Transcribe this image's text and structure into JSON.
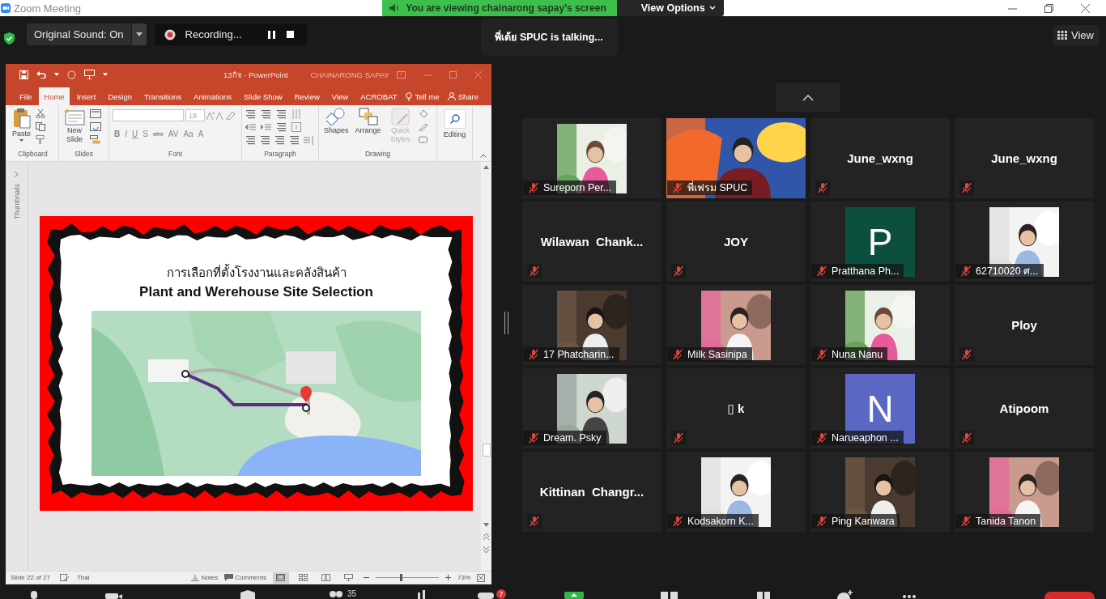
{
  "window": {
    "title": "Zoom Meeting"
  },
  "share_banner": {
    "text": "You are viewing chainarong sapay's screen",
    "view_options": "View Options"
  },
  "meeting_toolbar": {
    "original_sound": "Original Sound: On",
    "recording": "Recording...",
    "talking": "พี่เต้ย SPUC is talking...",
    "view": "View"
  },
  "powerpoint": {
    "title": "13กิจ  -  PowerPoint",
    "user": "CHAINARONG SAPAY",
    "tabs": [
      {
        "label": "File",
        "selected": false
      },
      {
        "label": "Home",
        "selected": true
      },
      {
        "label": "Insert",
        "selected": false
      },
      {
        "label": "Design",
        "selected": false
      },
      {
        "label": "Transitions",
        "selected": false
      },
      {
        "label": "Animations",
        "selected": false
      },
      {
        "label": "Slide Show",
        "selected": false
      },
      {
        "label": "Review",
        "selected": false
      },
      {
        "label": "View",
        "selected": false
      },
      {
        "label": "ACROBAT",
        "selected": false
      }
    ],
    "tell_me": "Tell me",
    "share": "Share",
    "ribbon": [
      {
        "kind": "clipboard",
        "label": "Clipboard",
        "button": "Paste"
      },
      {
        "kind": "slides",
        "label": "Slides",
        "button": "New Slide"
      },
      {
        "kind": "font",
        "label": "Font",
        "font_size": "18",
        "buttons": [
          "B",
          "I",
          "U",
          "S",
          "abc",
          "AV",
          "Aa",
          "A"
        ]
      },
      {
        "kind": "paragraph",
        "label": "Paragraph"
      },
      {
        "kind": "drawing",
        "label": "Drawing",
        "buttons": [
          {
            "label": "Shapes",
            "disabled": false
          },
          {
            "label": "Arrange",
            "disabled": false
          },
          {
            "label": "Quick Styles",
            "disabled": true
          }
        ]
      },
      {
        "kind": "editing",
        "button": "Editing"
      }
    ],
    "thumbnails_label": "Thumbnails",
    "slide": {
      "title_th": "การเลือกที่ตั้งโรงงานและคลังสินค้า",
      "title_en": "Plant and Werehouse Site Selection"
    },
    "status_bar": {
      "slide": "Slide 22 of 27",
      "language": "Thai",
      "notes": "Notes",
      "comments": "Comments",
      "zoom": "73%",
      "zoom_slider": {
        "level": 0.4
      }
    }
  },
  "gallery": {
    "tiles": [
      {
        "name": "Sureporn Per...",
        "muted": true
      },
      {
        "kind": "video",
        "name": "พี่เฟรม SPUC",
        "muted": true
      },
      {
        "kind": "name",
        "name": "June_wxng",
        "muted": true
      },
      {
        "kind": "name",
        "name": "June_wxng",
        "muted": true
      },
      {
        "kind": "name",
        "name": "Wilawan  Chank...",
        "muted": true
      },
      {
        "kind": "name",
        "name": "JOY",
        "muted": true
      },
      {
        "kind": "avatar",
        "name": "Pratthana Ph...",
        "letter": "P",
        "color": "#0c4f3e",
        "muted": true
      },
      {
        "name": "62710020 ศ...",
        "muted": true
      },
      {
        "name": "17 Phatcharin...",
        "muted": true
      },
      {
        "name": "Milk Sasinipa",
        "muted": true
      },
      {
        "name": "Nuna Nanu",
        "muted": true
      },
      {
        "kind": "name",
        "name": "Ploy",
        "muted": true
      },
      {
        "name": "Dream. Psky",
        "muted": true
      },
      {
        "kind": "name",
        "name": "▯ k",
        "muted": true
      },
      {
        "kind": "avatar",
        "name": "Narueaphon ...",
        "letter": "N",
        "color": "#5a68c4",
        "muted": true
      },
      {
        "kind": "name",
        "name": "Atipoom",
        "muted": true
      },
      {
        "kind": "name",
        "name": "Kittinan  Changr...",
        "muted": true
      },
      {
        "name": "Kodsakorn K...",
        "muted": true
      },
      {
        "name": "Ping Kanwara",
        "muted": true
      },
      {
        "name": "Tanida Tanon",
        "muted": true
      }
    ]
  },
  "bottom_bar": {
    "participants_count": "35",
    "chat_badge": "7"
  }
}
